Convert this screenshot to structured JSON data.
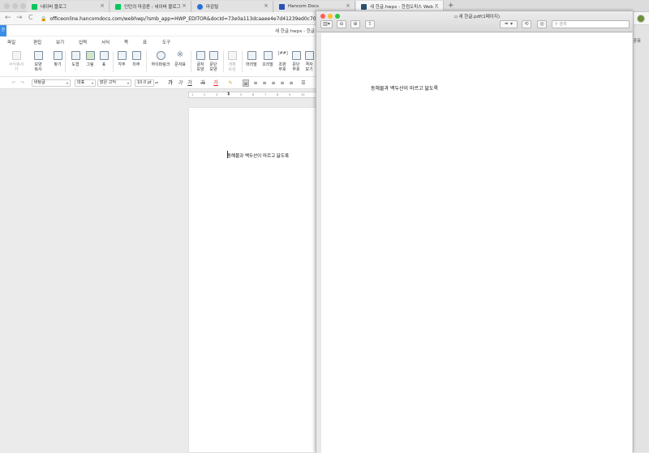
{
  "browser": {
    "tabs": [
      {
        "label": "네이버 블로그",
        "favicon_color": "#03c75a"
      },
      {
        "label": "인턴의 마감론 : 네이버 블로그",
        "favicon_color": "#03c75a"
      },
      {
        "label": "마감털",
        "favicon_color": "#2a6fdb"
      },
      {
        "label": "Hancom Docs",
        "favicon_color": "#2a4fb8"
      },
      {
        "label": "새 한글.hwpx - 한컴오피스 Web ...",
        "favicon_color": "#2a4f6e"
      }
    ],
    "new_tab": "+",
    "back": "←",
    "forward": "→",
    "reload": "C",
    "url": "officeonline.hancomdocs.com/webhwp/?smb_app=HWP_EDITOR&docId=73e0a113dcaaee4e7d41239ed0c708b9&la"
  },
  "hancom": {
    "app_badge": "한",
    "doc_title": "새 한글.hwpx - 한글",
    "menu": [
      "파일",
      "편집",
      "보기",
      "입력",
      "서식",
      "쪽",
      "표",
      "도구"
    ],
    "ribbon": [
      {
        "label": "서식복사\n가",
        "disabled": true
      },
      {
        "label": "모양\n복사",
        "disabled": false
      },
      {
        "label": "찾기",
        "disabled": false
      },
      {
        "label": "도형\n·",
        "disabled": false
      },
      {
        "label": "그림",
        "disabled": false
      },
      {
        "label": "표\n·",
        "disabled": false
      },
      {
        "label": "각주",
        "disabled": false
      },
      {
        "label": "미주",
        "disabled": false
      },
      {
        "label": "하이퍼링크",
        "disabled": false
      },
      {
        "label": "문자표",
        "disabled": false
      },
      {
        "label": "글자\n모양",
        "disabled": false
      },
      {
        "label": "문단\n모양",
        "disabled": false
      },
      {
        "label": "개체\n속성",
        "disabled": true
      },
      {
        "label": "머리말\n·",
        "disabled": false
      },
      {
        "label": "꼬리말\n·",
        "disabled": false
      },
      {
        "label": "조판\n부호",
        "disabled": false
      },
      {
        "label": "문단\n부호",
        "disabled": false
      },
      {
        "label": "격자\n보기",
        "disabled": false
      }
    ],
    "format": {
      "undo": "↶",
      "redo": "↷",
      "style": "바탕글",
      "font_group": "대표",
      "font": "맑은 고딕",
      "size": "10.0",
      "unit": "pt",
      "bold": "가",
      "italic": "가",
      "underline": "가",
      "strike": "가",
      "font_color": "가"
    },
    "ruler_ticks": [
      "1",
      "2",
      "3",
      "4",
      "5",
      "6",
      "7",
      "8",
      "9",
      "10"
    ],
    "doc_text": "동해물과 백두산이 마르고 닳도록"
  },
  "share_label": "공유",
  "preview": {
    "title": "새 한글.pdf(1페이지)",
    "search_placeholder": "검색",
    "pdf_text": "동해물과 백두산이 마르고 닳도록"
  }
}
